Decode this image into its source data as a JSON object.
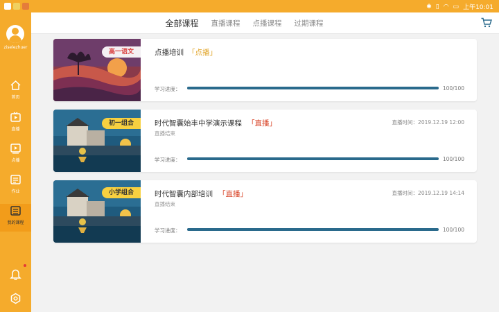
{
  "colors": {
    "accent": "#f5ab2c",
    "progress": "#2a6a8c",
    "vod_tag": "#e0a325",
    "live_tag": "#d9472b"
  },
  "statusbar": {
    "time": "上午10:01",
    "icons": [
      "bluetooth-icon",
      "vibrate-icon",
      "wifi-icon",
      "battery-icon"
    ]
  },
  "sidebar": {
    "username": "ziselezhuer",
    "items": [
      {
        "label": "首页",
        "icon": "home-icon"
      },
      {
        "label": "直播",
        "icon": "live-icon"
      },
      {
        "label": "点播",
        "icon": "vod-icon"
      },
      {
        "label": "作业",
        "icon": "homework-icon"
      },
      {
        "label": "我的课程",
        "icon": "my-courses-icon"
      }
    ],
    "bottom_icons": [
      "bell-icon",
      "settings-icon"
    ]
  },
  "header": {
    "tabs": [
      "全部课程",
      "直播课程",
      "点播课程",
      "过期课程"
    ],
    "active_tab": "全部课程",
    "cart_icon": "cart-icon"
  },
  "courses": [
    {
      "thumb_tag": "高一语文",
      "title": "点播培训",
      "type": "「点播」",
      "live_status": "",
      "live_time": "",
      "progress_label": "学习进度：",
      "progress": 100,
      "progress_text": "100/100"
    },
    {
      "thumb_tag": "初一组合",
      "title": "时代智囊始丰中学演示课程",
      "type": "「直播」",
      "live_status": "直播结束",
      "live_time": "直播时间：2019.12.19 12:00",
      "progress_label": "学习进度：",
      "progress": 100,
      "progress_text": "100/100"
    },
    {
      "thumb_tag": "小学组合",
      "title": "时代智囊内部培训",
      "type": "「直播」",
      "live_status": "直播结束",
      "live_time": "直播时间：2019.12.19 14:14",
      "progress_label": "学习进度：",
      "progress": 100,
      "progress_text": "100/100"
    }
  ]
}
